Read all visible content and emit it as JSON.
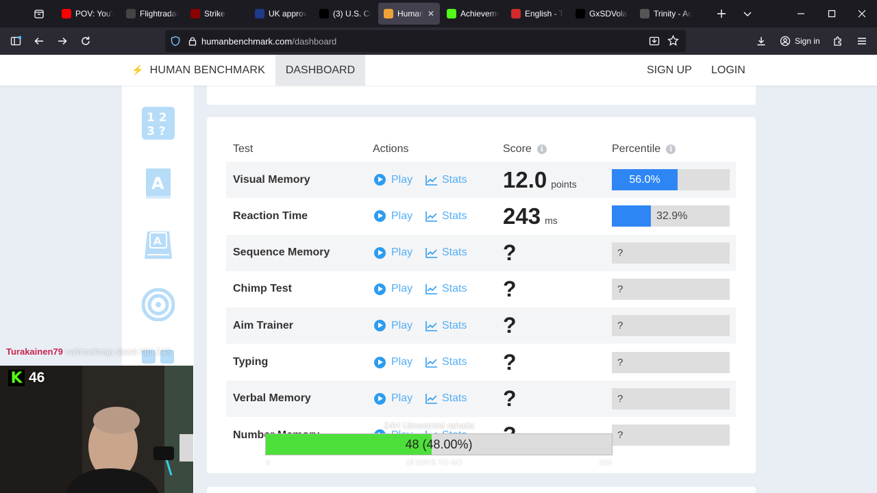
{
  "browser": {
    "tabs": [
      {
        "title": "POV: You'r",
        "icon": "youtube-icon",
        "color": "#ff0000",
        "active": false
      },
      {
        "title": "Flightradar",
        "icon": "flightradar-icon",
        "color": "#444444",
        "active": false
      },
      {
        "title": "Strike",
        "icon": "audio-muted-icon",
        "color": "#8b0000",
        "active": false
      },
      {
        "title": "UK approv",
        "icon": "news-icon",
        "color": "#1e3a8a",
        "active": false
      },
      {
        "title": "(3) U.S. Ce",
        "icon": "x-icon",
        "color": "#000000",
        "active": false
      },
      {
        "title": "Human",
        "icon": "humanbenchmark-icon",
        "color": "#f0a23a",
        "active": true
      },
      {
        "title": "Achieveme",
        "icon": "kick-icon",
        "color": "#53fc18",
        "active": false
      },
      {
        "title": "English - T",
        "icon": "translate-icon",
        "color": "#d22b2b",
        "active": false
      },
      {
        "title": "GxSDVolal",
        "icon": "x-icon",
        "color": "#000000",
        "active": false
      },
      {
        "title": "Trinity - Ac",
        "icon": "trinity-icon",
        "color": "#555555",
        "active": false
      }
    ],
    "url_domain": "humanbenchmark.com",
    "url_path": "/dashboard",
    "sign_in_label": "Sign in"
  },
  "site": {
    "brand": "HUMAN BENCHMARK",
    "nav_dashboard": "DASHBOARD",
    "sign_up": "SIGN UP",
    "login": "LOGIN"
  },
  "table": {
    "headers": {
      "test": "Test",
      "actions": "Actions",
      "score": "Score",
      "percentile": "Percentile"
    },
    "play_label": "Play",
    "stats_label": "Stats",
    "rows": [
      {
        "name": "Visual Memory",
        "score": "12.0",
        "unit": "points",
        "percentile": 56.0,
        "percentile_label": "56.0%"
      },
      {
        "name": "Reaction Time",
        "score": "243",
        "unit": "ms",
        "percentile": 32.9,
        "percentile_label": "32.9%"
      },
      {
        "name": "Sequence Memory",
        "score": "?",
        "unit": "",
        "percentile": null,
        "percentile_label": "?"
      },
      {
        "name": "Chimp Test",
        "score": "?",
        "unit": "",
        "percentile": null,
        "percentile_label": "?"
      },
      {
        "name": "Aim Trainer",
        "score": "?",
        "unit": "",
        "percentile": null,
        "percentile_label": "?"
      },
      {
        "name": "Typing",
        "score": "?",
        "unit": "",
        "percentile": null,
        "percentile_label": "?"
      },
      {
        "name": "Verbal Memory",
        "score": "?",
        "unit": "",
        "percentile": null,
        "percentile_label": "?"
      },
      {
        "name": "Number Memory",
        "score": "?",
        "unit": "",
        "percentile": null,
        "percentile_label": "?"
      }
    ]
  },
  "stream": {
    "chat_user": "Turakainen79",
    "chat_message": "vaihtoehtoja tässä lähi 243",
    "viewer_count": "46",
    "goal_title": "24H Ulmestrimi rahatia",
    "goal_text": "48 (48.00%)",
    "goal_fraction": 0.48,
    "goal_min": "0",
    "goal_days": "15 DAYS TO GO",
    "goal_max": "100"
  }
}
